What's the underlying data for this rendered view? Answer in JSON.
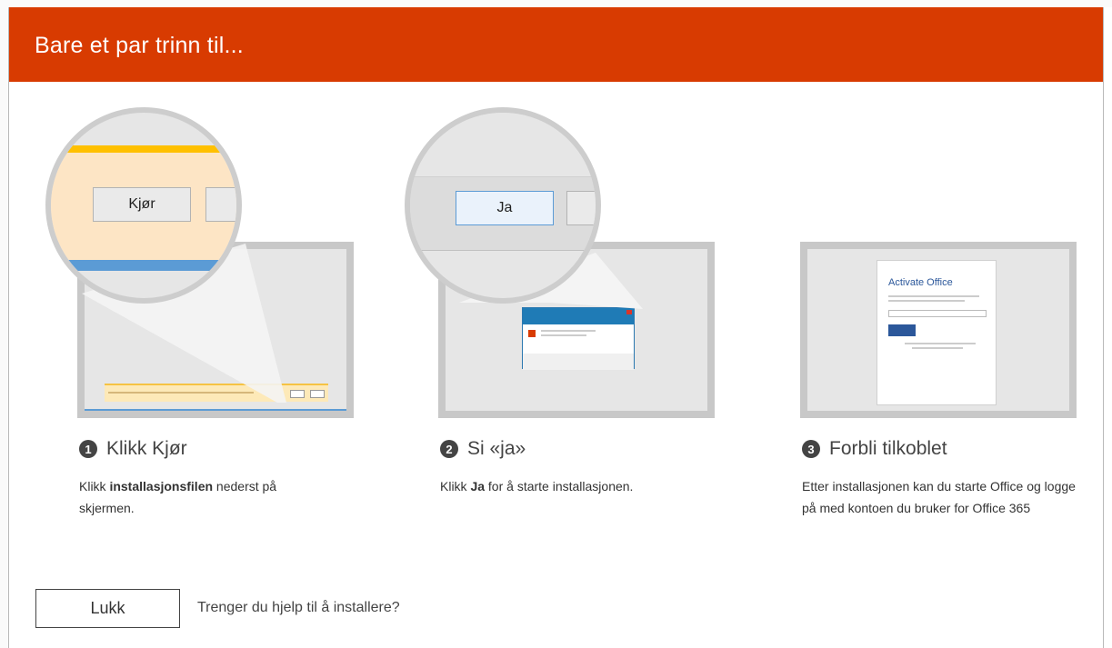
{
  "dialog": {
    "title": "Bare et par trinn til...",
    "accent_color": "#d83b01"
  },
  "steps": [
    {
      "number": "1",
      "title": "Klikk Kjør",
      "desc_pre": "Klikk ",
      "desc_bold": "installasjonsfilen",
      "desc_post": " nederst på skjermen.",
      "zoom_button": "Kjør"
    },
    {
      "number": "2",
      "title": "Si «ja»",
      "desc_pre": "Klikk ",
      "desc_bold": "Ja",
      "desc_post": " for å starte installasjonen.",
      "zoom_button": "Ja"
    },
    {
      "number": "3",
      "title": "Forbli tilkoblet",
      "desc_pre": "Etter installasjonen kan du starte Office og logge på med kontoen du bruker for Office 365",
      "desc_bold": "",
      "desc_post": "",
      "activate_title": "Activate Office"
    }
  ],
  "footer": {
    "close_label": "Lukk",
    "help_text": "Trenger du hjelp til å installere?"
  }
}
